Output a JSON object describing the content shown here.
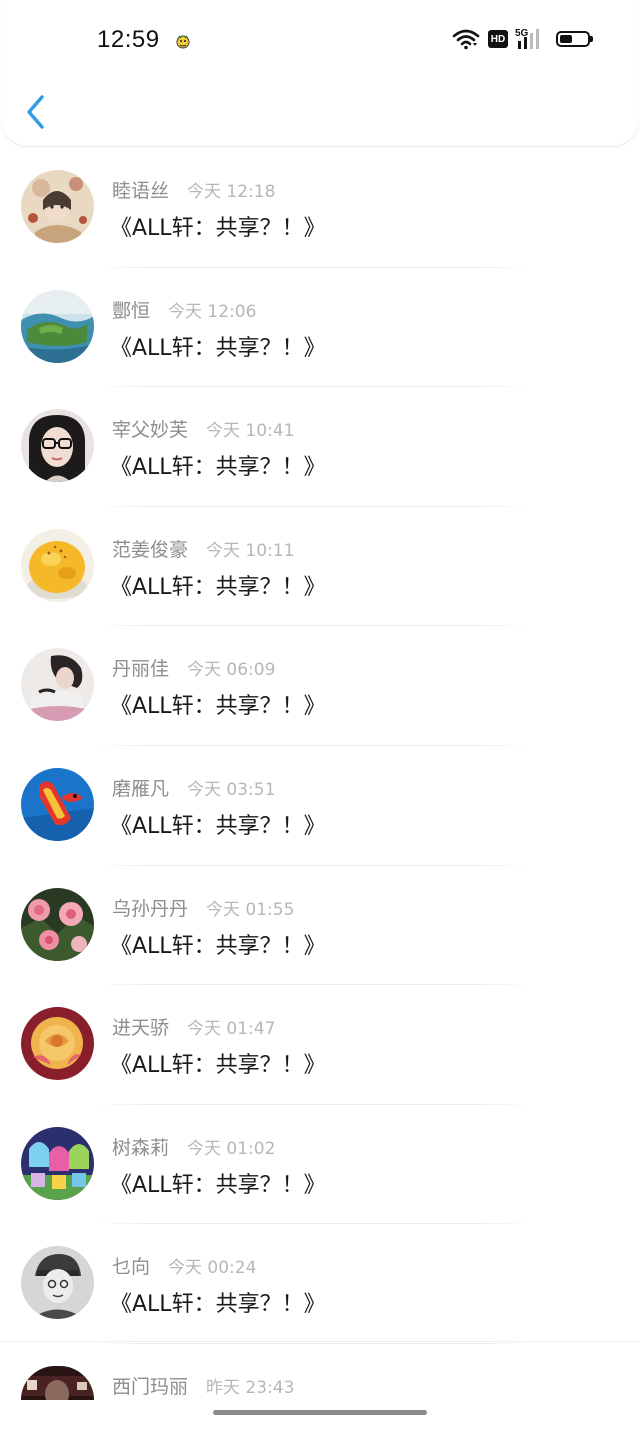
{
  "status_bar": {
    "time": "12:59",
    "network": "5G",
    "hd": "HD",
    "battery_level": 0.45,
    "icons": [
      "bug-icon",
      "wifi-icon",
      "hd-icon",
      "cellular-5g-icon",
      "battery-icon"
    ]
  },
  "header": {
    "back_icon": "chevron-left-icon",
    "accent_color": "#2d9be8"
  },
  "messages": [
    {
      "name": "睦语丝",
      "time": "今天 12:18",
      "text": "《ALL轩：共享？！》",
      "avatar_icon": "avatar-illustration"
    },
    {
      "name": "酆恒",
      "time": "今天 12:06",
      "text": "《ALL轩：共享？！》",
      "avatar_icon": "avatar-landscape"
    },
    {
      "name": "宰父妙芙",
      "time": "今天 10:41",
      "text": "《ALL轩：共享？！》",
      "avatar_icon": "avatar-portrait-glasses"
    },
    {
      "name": "范姜俊豪",
      "time": "今天 10:11",
      "text": "《ALL轩：共享？！》",
      "avatar_icon": "avatar-food"
    },
    {
      "name": "丹丽佳",
      "time": "今天 06:09",
      "text": "《ALL轩：共享？！》",
      "avatar_icon": "avatar-girl"
    },
    {
      "name": "磨雁凡",
      "time": "今天 03:51",
      "text": "《ALL轩：共享？！》",
      "avatar_icon": "avatar-toy"
    },
    {
      "name": "乌孙丹丹",
      "time": "今天 01:55",
      "text": "《ALL轩：共享？！》",
      "avatar_icon": "avatar-roses"
    },
    {
      "name": "进天骄",
      "time": "今天 01:47",
      "text": "《ALL轩：共享？！》",
      "avatar_icon": "avatar-rose"
    },
    {
      "name": "树森莉",
      "time": "今天 01:02",
      "text": "《ALL轩：共享？！》",
      "avatar_icon": "avatar-cartoon"
    },
    {
      "name": "乜向",
      "time": "今天 00:24",
      "text": "《ALL轩：共享？！》",
      "avatar_icon": "avatar-sketch"
    },
    {
      "name": "西门玛丽",
      "time": "昨天 23:43",
      "text": "",
      "avatar_icon": "avatar-dark-portrait"
    }
  ]
}
